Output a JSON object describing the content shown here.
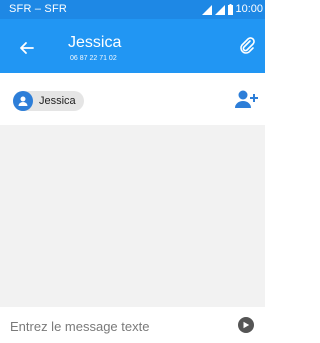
{
  "status_bar": {
    "carrier": "SFR – SFR",
    "time": "10:00",
    "icons": [
      "signal-icon",
      "signal-icon",
      "battery-icon"
    ]
  },
  "header": {
    "title": "Jessica",
    "subtitle": "06 87 22 71 02",
    "back_icon": "arrow-back-icon",
    "attach_icon": "paperclip-icon"
  },
  "recipients": {
    "chips": [
      {
        "name": "Jessica",
        "icon": "person-icon"
      }
    ],
    "add_icon": "add-contact-icon"
  },
  "compose": {
    "placeholder": "Entrez le message texte",
    "send_icon": "send-icon"
  },
  "colors": {
    "status_bar": "#1e88e5",
    "app_bar": "#2196f3",
    "accent": "#2d7ed8",
    "conversation_bg": "#f2f2f2",
    "chip_bg": "#e5e5e5"
  }
}
